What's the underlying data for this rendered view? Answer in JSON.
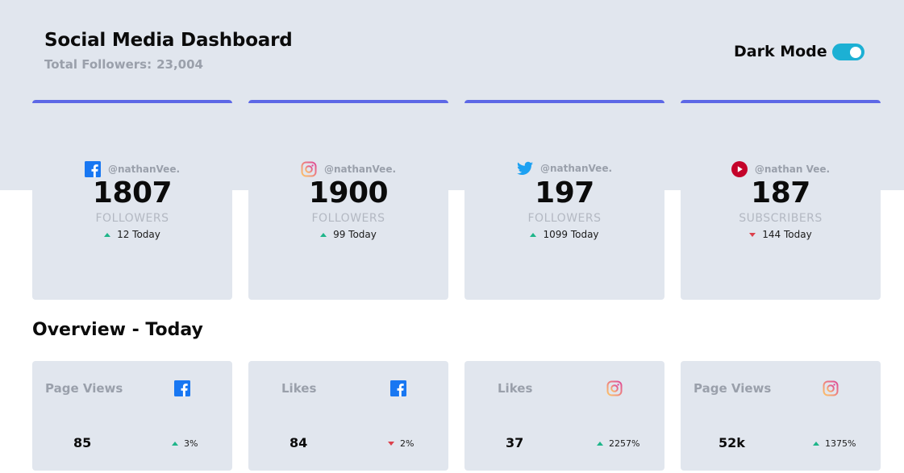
{
  "header": {
    "title": "Social Media Dashboard",
    "total_label": "Total Followers:",
    "total_value": "23,004",
    "dark_mode_label": "Dark Mode",
    "dark_mode_on": true
  },
  "colors": {
    "accent_bar": "#5d68e6",
    "toggle": "#1cb0d4",
    "up": "#1eb589",
    "down": "#dc414c",
    "card_bg": "#e1e6ee"
  },
  "stats": [
    {
      "platform_icon": "facebook-icon",
      "handle": "@nathanVee.",
      "count": "1807",
      "label": "FOLLOWERS",
      "trend": "up",
      "change": "12 Today"
    },
    {
      "platform_icon": "instagram-icon",
      "handle": "@nathanVee.",
      "count": "1900",
      "label": "FOLLOWERS",
      "trend": "up",
      "change": "99 Today"
    },
    {
      "platform_icon": "twitter-icon",
      "handle": "@nathanVee.",
      "count": "197",
      "label": "FOLLOWERS",
      "trend": "up",
      "change": "1099 Today"
    },
    {
      "platform_icon": "youtube-icon",
      "handle": "@nathan Vee.",
      "count": "187",
      "label": "SUBSCRIBERS",
      "trend": "down",
      "change": "144 Today"
    }
  ],
  "overview": {
    "title": "Overview - Today",
    "cards": [
      {
        "label": "Page Views",
        "platform_icon": "facebook-icon",
        "value": "85",
        "trend": "up",
        "change": "3%"
      },
      {
        "label": "Likes",
        "platform_icon": "facebook-icon",
        "value": "84",
        "trend": "down",
        "change": "2%"
      },
      {
        "label": "Likes",
        "platform_icon": "instagram-icon",
        "value": "37",
        "trend": "up",
        "change": "2257%"
      },
      {
        "label": "Page Views",
        "platform_icon": "instagram-icon",
        "value": "52k",
        "trend": "up",
        "change": "1375%"
      }
    ]
  }
}
